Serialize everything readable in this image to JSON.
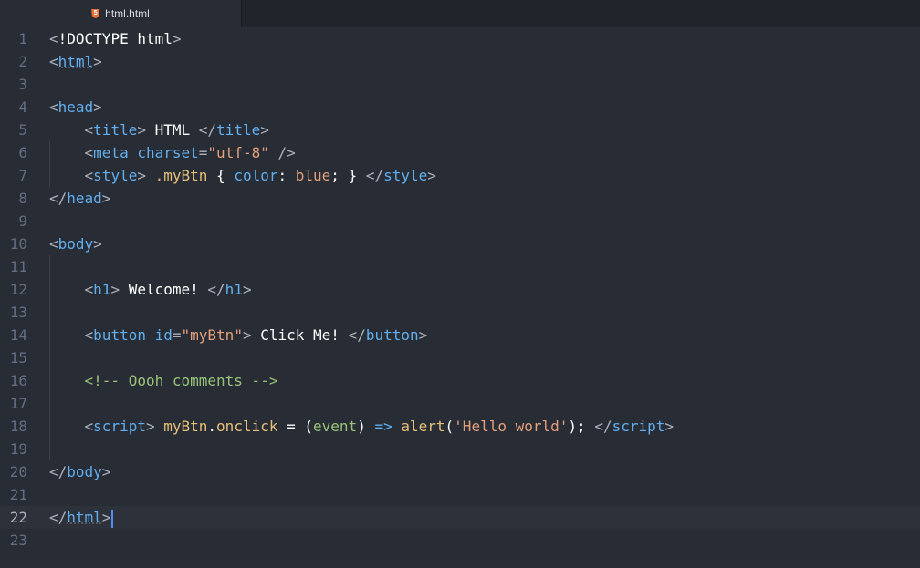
{
  "tab": {
    "filename": "html.html",
    "icon": "html5-icon"
  },
  "colors": {
    "background": "#282c34",
    "accent": "#528bff"
  },
  "cursor": {
    "line": 22
  },
  "lines": [
    {
      "num": "1",
      "tokens": [
        [
          "t-punct",
          "<"
        ],
        [
          "t-doctype",
          "!DOCTYPE html"
        ],
        [
          "t-punct",
          ">"
        ]
      ]
    },
    {
      "num": "2",
      "tokens": [
        [
          "t-punct",
          "<"
        ],
        [
          "t-tag t-underline",
          "html"
        ],
        [
          "t-punct",
          ">"
        ]
      ]
    },
    {
      "num": "3",
      "tokens": []
    },
    {
      "num": "4",
      "tokens": [
        [
          "t-punct",
          "<"
        ],
        [
          "t-tag",
          "head"
        ],
        [
          "t-punct",
          ">"
        ]
      ]
    },
    {
      "num": "5",
      "tokens": [
        [
          "t-punct",
          "    <"
        ],
        [
          "t-tag",
          "title"
        ],
        [
          "t-punct",
          "> "
        ],
        [
          "t-text",
          "HTML"
        ],
        [
          "t-punct",
          " </"
        ],
        [
          "t-tag",
          "title"
        ],
        [
          "t-punct",
          ">"
        ]
      ]
    },
    {
      "num": "6",
      "tokens": [
        [
          "t-punct",
          "    <"
        ],
        [
          "t-tag",
          "meta"
        ],
        [
          "t-punct",
          " "
        ],
        [
          "t-prop",
          "charset"
        ],
        [
          "t-punct",
          "="
        ],
        [
          "t-str",
          "\"utf-8\""
        ],
        [
          "t-punct",
          " />"
        ]
      ]
    },
    {
      "num": "7",
      "tokens": [
        [
          "t-punct",
          "    <"
        ],
        [
          "t-tag",
          "style"
        ],
        [
          "t-punct",
          "> "
        ],
        [
          "t-ident",
          ".myBtn"
        ],
        [
          "t-text",
          " { "
        ],
        [
          "t-prop",
          "color"
        ],
        [
          "t-text",
          ": "
        ],
        [
          "t-val",
          "blue"
        ],
        [
          "t-text",
          "; } "
        ],
        [
          "t-punct",
          "</"
        ],
        [
          "t-tag",
          "style"
        ],
        [
          "t-punct",
          ">"
        ]
      ]
    },
    {
      "num": "8",
      "tokens": [
        [
          "t-punct",
          "</"
        ],
        [
          "t-tag",
          "head"
        ],
        [
          "t-punct",
          ">"
        ]
      ]
    },
    {
      "num": "9",
      "tokens": []
    },
    {
      "num": "10",
      "tokens": [
        [
          "t-punct",
          "<"
        ],
        [
          "t-tag",
          "body"
        ],
        [
          "t-punct",
          ">"
        ]
      ]
    },
    {
      "num": "11",
      "tokens": []
    },
    {
      "num": "12",
      "tokens": [
        [
          "t-punct",
          "    <"
        ],
        [
          "t-tag",
          "h1"
        ],
        [
          "t-punct",
          "> "
        ],
        [
          "t-text",
          "Welcome!"
        ],
        [
          "t-punct",
          " </"
        ],
        [
          "t-tag",
          "h1"
        ],
        [
          "t-punct",
          ">"
        ]
      ]
    },
    {
      "num": "13",
      "tokens": []
    },
    {
      "num": "14",
      "tokens": [
        [
          "t-punct",
          "    <"
        ],
        [
          "t-tag",
          "button"
        ],
        [
          "t-punct",
          " "
        ],
        [
          "t-prop",
          "id"
        ],
        [
          "t-punct",
          "="
        ],
        [
          "t-str",
          "\"myBtn\""
        ],
        [
          "t-punct",
          "> "
        ],
        [
          "t-text",
          "Click Me!"
        ],
        [
          "t-punct",
          " </"
        ],
        [
          "t-tag",
          "button"
        ],
        [
          "t-punct",
          ">"
        ]
      ]
    },
    {
      "num": "15",
      "tokens": []
    },
    {
      "num": "16",
      "tokens": [
        [
          "t-comment",
          "    <!-- Oooh comments -->"
        ]
      ]
    },
    {
      "num": "17",
      "tokens": []
    },
    {
      "num": "18",
      "tokens": [
        [
          "t-punct",
          "    <"
        ],
        [
          "t-tag",
          "script"
        ],
        [
          "t-punct",
          "> "
        ],
        [
          "t-ident",
          "myBtn"
        ],
        [
          "t-text",
          "."
        ],
        [
          "t-ident",
          "onclick"
        ],
        [
          "t-text",
          " = ("
        ],
        [
          "t-comment",
          "event"
        ],
        [
          "t-text",
          ") "
        ],
        [
          "t-tag",
          "=>"
        ],
        [
          "t-text",
          " "
        ],
        [
          "t-ident",
          "alert"
        ],
        [
          "t-text",
          "("
        ],
        [
          "t-str",
          "'Hello world'"
        ],
        [
          "t-text",
          "); "
        ],
        [
          "t-punct",
          "</"
        ],
        [
          "t-tag",
          "script"
        ],
        [
          "t-punct",
          ">"
        ]
      ]
    },
    {
      "num": "19",
      "tokens": []
    },
    {
      "num": "20",
      "tokens": [
        [
          "t-punct",
          "</"
        ],
        [
          "t-tag",
          "body"
        ],
        [
          "t-punct",
          ">"
        ]
      ]
    },
    {
      "num": "21",
      "tokens": []
    },
    {
      "num": "22",
      "tokens": [
        [
          "t-punct",
          "</"
        ],
        [
          "t-tag t-underline",
          "html"
        ],
        [
          "t-punct",
          ">"
        ]
      ]
    },
    {
      "num": "23",
      "tokens": []
    }
  ]
}
